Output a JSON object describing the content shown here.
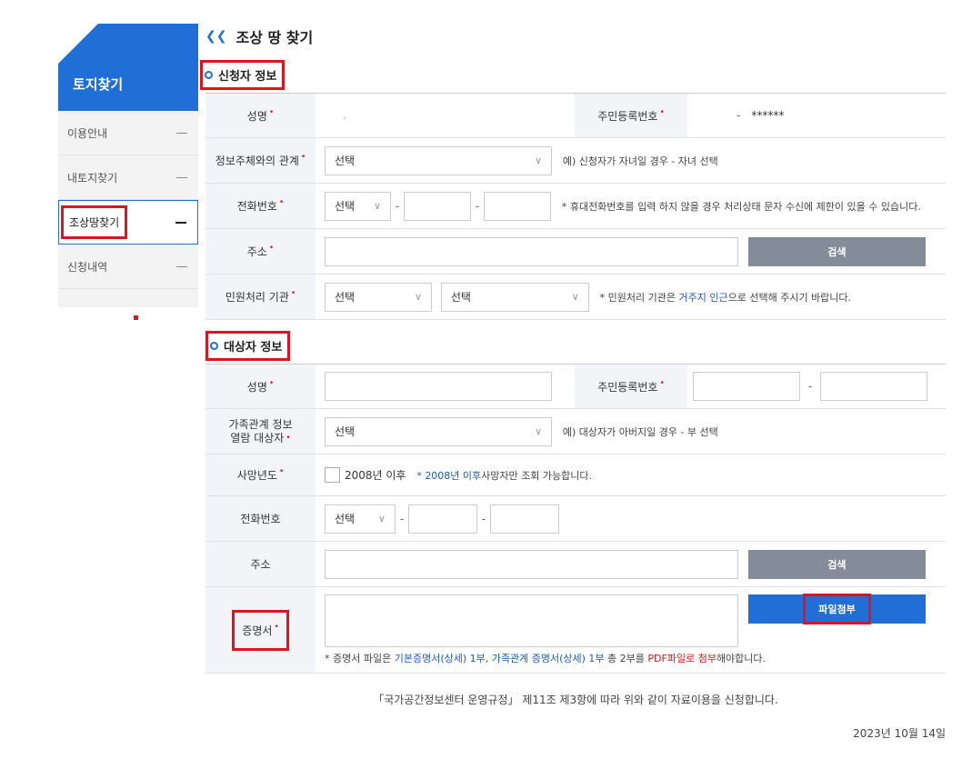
{
  "sidebar": {
    "title": "토지찾기",
    "items": [
      {
        "label": "이용안내"
      },
      {
        "label": "내토지찾기"
      },
      {
        "label": "조상땅찾기"
      },
      {
        "label": "신청내역"
      }
    ]
  },
  "page_title": "조상 땅 찾기",
  "applicant": {
    "section_title": "신청자 정보",
    "name_label": "성명",
    "name_value": ".",
    "rrn_label": "주민등록번호",
    "rrn_value": "-",
    "rrn_masked": "******",
    "relation_label": "정보주체와의 관계",
    "relation_select": "선택",
    "relation_note": "예) 신청자가 자녀일 경우 - 자녀 선택",
    "phone_label": "전화번호",
    "phone_select": "선택",
    "phone_note": "* 휴대전화번호를 입력 하지 않을 경우 처리상태 문자 수신에 제한이 있을 수 있습니다.",
    "address_label": "주소",
    "search_button": "검색",
    "agency_label": "민원처리 기관",
    "agency_select1": "선택",
    "agency_select2": "선택",
    "agency_note_pre": "* 민원처리 기관은 ",
    "agency_note_link": "거주지 인근",
    "agency_note_post": "으로 선택해 주시기 바랍니다."
  },
  "target": {
    "section_title": "대상자 정보",
    "name_label": "성명",
    "rrn_label": "주민등록번호",
    "family_label_1": "가족관계 정보",
    "family_label_2": "열람 대상자",
    "family_select": "선택",
    "family_note": "예) 대상자가 아버지일 경우 - 부 선택",
    "death_label": "사망년도",
    "death_checkbox": "2008년 이후",
    "death_note_star": "* ",
    "death_note_link": "2008년 이후",
    "death_note_post": "사망자만 조회 가능합니다.",
    "phone_label": "전화번호",
    "phone_select": "선택",
    "address_label": "주소",
    "search_button": "검색",
    "cert_label": "증명서",
    "attach_button": "파일첨부",
    "cert_note_1": "* 증명서 파일은 ",
    "cert_note_2": "기본증명서(상세) 1부",
    "cert_note_3": ", ",
    "cert_note_4": "가족관계 증명서(상세) 1부",
    "cert_note_5": " 총 2부를 ",
    "cert_note_6": "PDF파일로 첨부",
    "cert_note_7": "해야합니다."
  },
  "consent": "「국가공간정보센터 운영규정」 제11조 제3항에 따라 위와 같이 자료이용을 신청합니다.",
  "date": "2023년 10월 14일",
  "required_mark": "•",
  "colors": {
    "accent": "#1f6fd6",
    "highlight": "#e0141e",
    "gray_button": "#858c99"
  }
}
